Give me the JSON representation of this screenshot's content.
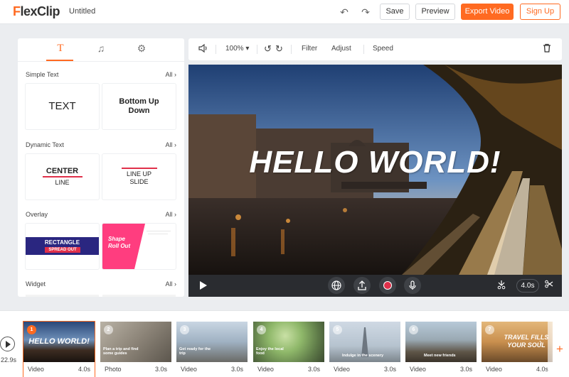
{
  "header": {
    "logo_prefix": "F",
    "logo_rest": "lexClip",
    "title": "Untitled",
    "save": "Save",
    "preview": "Preview",
    "export": "Export Video",
    "signup": "Sign Up",
    "colors": {
      "accent": "#ff6a21"
    }
  },
  "panel": {
    "tabs": [
      {
        "icon": "text-icon",
        "glyph": "T"
      },
      {
        "icon": "music-icon",
        "glyph": "♫"
      },
      {
        "icon": "settings-icon",
        "glyph": "⚙"
      }
    ],
    "sections": [
      {
        "title": "Simple Text",
        "all": "All"
      },
      {
        "title": "Dynamic Text",
        "all": "All"
      },
      {
        "title": "Overlay",
        "all": "All"
      },
      {
        "title": "Widget",
        "all": "All"
      }
    ],
    "cards": {
      "text": "TEXT",
      "bud1": "Bottom Up",
      "bud2": "Down",
      "center1": "CENTER",
      "center2": "LINE",
      "lineup1": "LINE UP",
      "lineup2": "SLIDE",
      "rect1": "RECTANGLE",
      "rect2": "SPREAD OUT",
      "shape1": "Shape",
      "shape2": "Roll Out"
    }
  },
  "editor": {
    "zoom": "100%",
    "filter": "Filter",
    "adjust": "Adjust",
    "speed": "Speed",
    "overlay_text": "HELLO WORLD!",
    "duration": "4.0s"
  },
  "timeline": {
    "total": "22.9s",
    "clips": [
      {
        "num": "1",
        "type": "Video",
        "duration": "4.0s",
        "caption": "HELLO WORLD!"
      },
      {
        "num": "2",
        "type": "Photo",
        "duration": "3.0s",
        "caption": "Plan a trip and find some guides"
      },
      {
        "num": "3",
        "type": "Video",
        "duration": "3.0s",
        "caption": "Get ready for the trip"
      },
      {
        "num": "4",
        "type": "Video",
        "duration": "3.0s",
        "caption": "Enjoy the local food"
      },
      {
        "num": "5",
        "type": "Video",
        "duration": "3.0s",
        "caption": "Indulge in the scenery"
      },
      {
        "num": "6",
        "type": "Video",
        "duration": "3.0s",
        "caption": "Meet new friends"
      },
      {
        "num": "7",
        "type": "Video",
        "duration": "4.0s",
        "caption": "TRAVEL FILLS YOUR SOUL"
      }
    ]
  }
}
